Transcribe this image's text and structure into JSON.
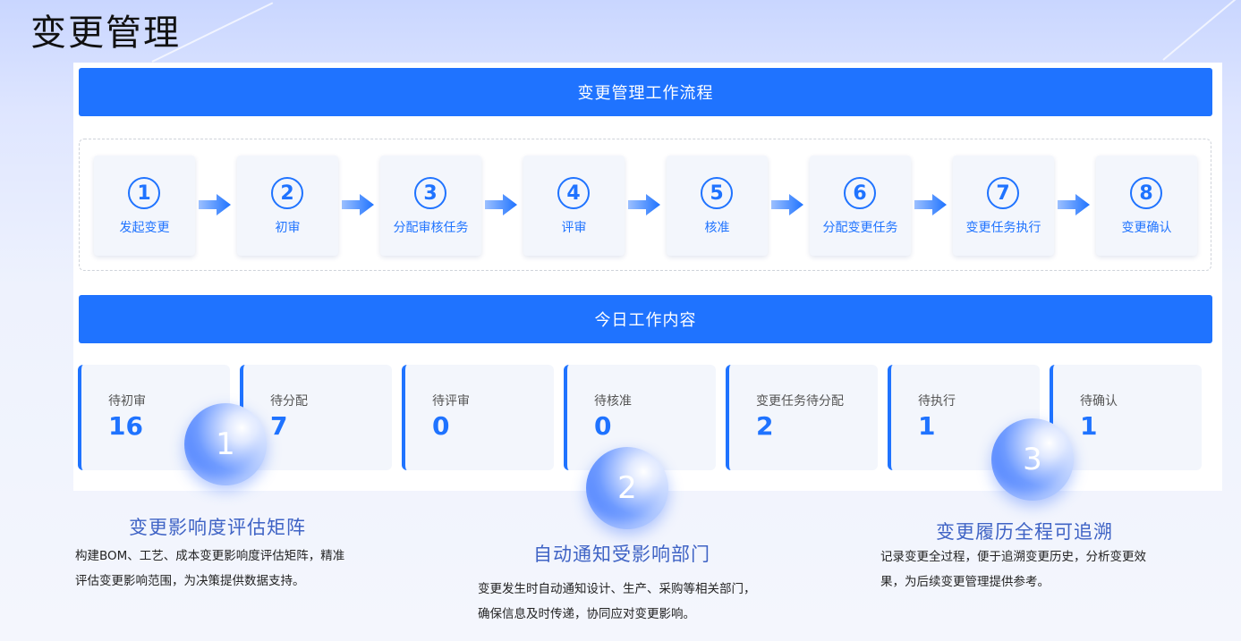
{
  "page_title": "变更管理",
  "workflow_header": "变更管理工作流程",
  "steps": [
    {
      "num": "1",
      "label": "发起变更"
    },
    {
      "num": "2",
      "label": "初审"
    },
    {
      "num": "3",
      "label": "分配审核任务"
    },
    {
      "num": "4",
      "label": "评审"
    },
    {
      "num": "5",
      "label": "核准"
    },
    {
      "num": "6",
      "label": "分配变更任务"
    },
    {
      "num": "7",
      "label": "变更任务执行"
    },
    {
      "num": "8",
      "label": "变更确认"
    }
  ],
  "today_header": "今日工作内容",
  "tasks": [
    {
      "label": "待初审",
      "value": "16"
    },
    {
      "label": "待分配",
      "value": "7"
    },
    {
      "label": "待评审",
      "value": "0"
    },
    {
      "label": "待核准",
      "value": "0"
    },
    {
      "label": "变更任务待分配",
      "value": "2"
    },
    {
      "label": "待执行",
      "value": "1"
    },
    {
      "label": "待确认",
      "value": "1"
    }
  ],
  "features": [
    {
      "num": "1",
      "title": "变更影响度评估矩阵",
      "desc1": "构建BOM、工艺、成本变更影响度评估矩阵，精准",
      "desc2": "评估变更影响范围，为决策提供数据支持。"
    },
    {
      "num": "2",
      "title": "自动通知受影响部门",
      "desc1": "变更发生时自动通知设计、生产、采购等相关部门，",
      "desc2": "确保信息及时传递，协同应对变更影响。"
    },
    {
      "num": "3",
      "title": "变更履历全程可追溯",
      "desc1": "记录变更全过程，便于追溯变更历史，分析变更效",
      "desc2": "果，为后续变更管理提供参考。"
    }
  ],
  "colors": {
    "accent": "#1f73ff",
    "feature_title": "#3f63c5"
  },
  "icons": {
    "flow_arrow": "arrow-right-icon"
  }
}
